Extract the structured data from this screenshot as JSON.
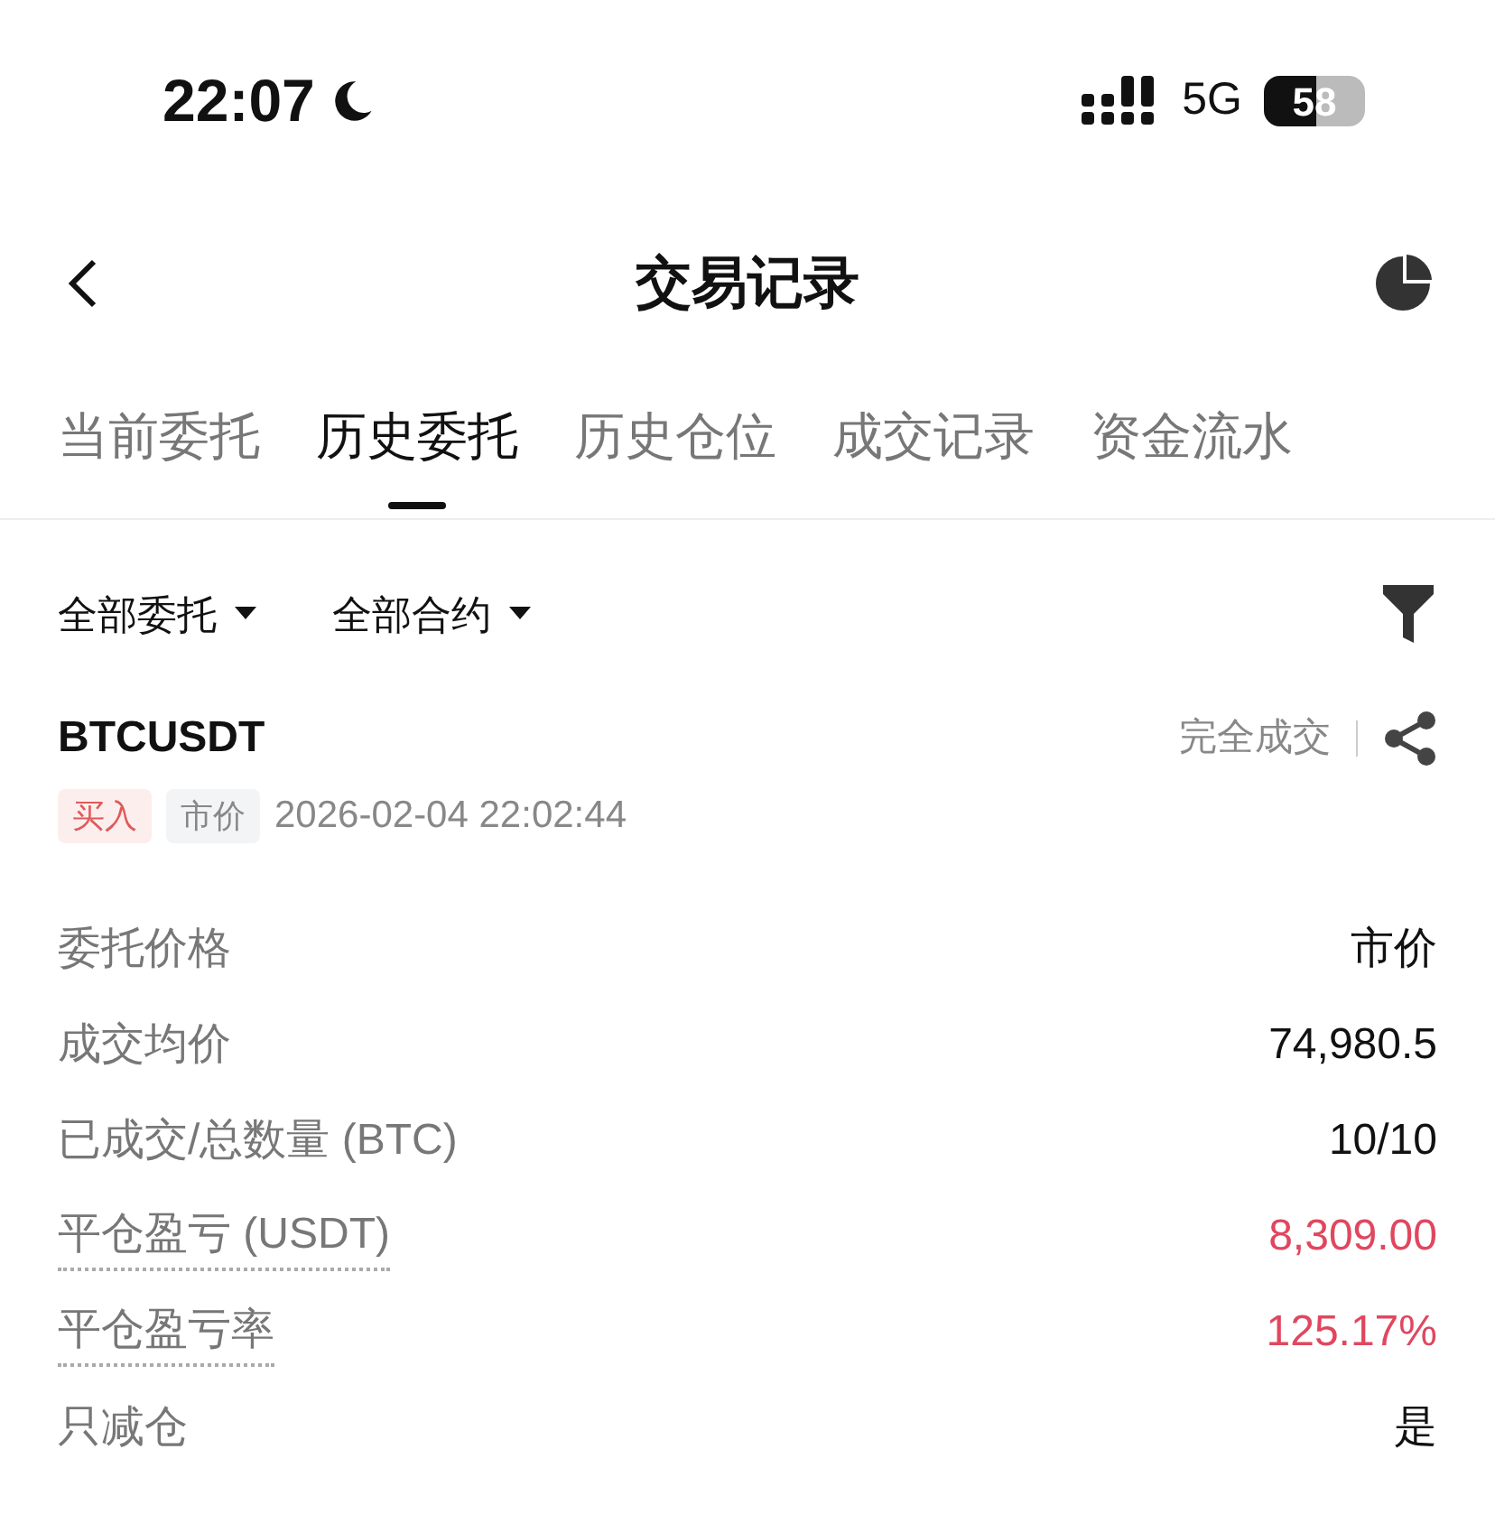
{
  "status_bar": {
    "time": "22:07",
    "network": "5G",
    "battery": "58"
  },
  "header": {
    "title": "交易记录"
  },
  "tabs": [
    {
      "label": "当前委托",
      "selected": false
    },
    {
      "label": "历史委托",
      "selected": true
    },
    {
      "label": "历史仓位",
      "selected": false
    },
    {
      "label": "成交记录",
      "selected": false
    },
    {
      "label": "资金流水",
      "selected": false
    }
  ],
  "filters": [
    "全部委托",
    "全部合约"
  ],
  "order": {
    "symbol": "BTCUSDT",
    "status": "完全成交",
    "side": "买入",
    "type": "市价",
    "time": "2026-02-04 22:02:44",
    "rows": [
      {
        "kind": "plain",
        "label": "委托价格",
        "value": "市价"
      },
      {
        "kind": "plain",
        "label": "成交均价",
        "value": "74,980.5"
      },
      {
        "kind": "plain",
        "label": "已成交/总数量 (BTC)",
        "value": "10/10"
      },
      {
        "kind": "pnl",
        "label": "平仓盈亏 (USDT)",
        "value": "8,309.00"
      },
      {
        "kind": "pnl",
        "label": "平仓盈亏率",
        "value": "125.17%"
      },
      {
        "kind": "plain",
        "label": "只减仓",
        "value": "是"
      }
    ]
  }
}
